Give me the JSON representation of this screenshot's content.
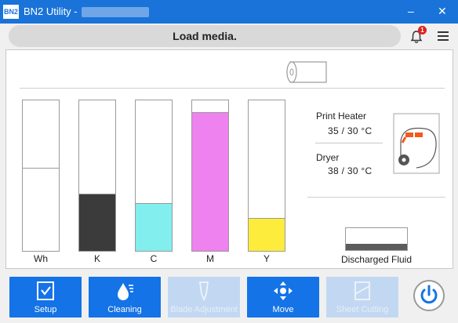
{
  "window": {
    "logo_text": "BN2",
    "title": "BN2 Utility -",
    "minimize_glyph": "–",
    "close_glyph": "✕"
  },
  "status": {
    "message": "Load media.",
    "notification_count": "1"
  },
  "ink_tanks": [
    {
      "label": "Wh",
      "level": 0.55,
      "color": "#ffffff"
    },
    {
      "label": "K",
      "level": 0.38,
      "color": "#3b3b3b"
    },
    {
      "label": "C",
      "level": 0.32,
      "color": "#82eeee"
    },
    {
      "label": "M",
      "level": 0.92,
      "color": "#ee82ee"
    },
    {
      "label": "Y",
      "level": 0.22,
      "color": "#fdec3c"
    }
  ],
  "heaters": {
    "print_heater_label": "Print Heater",
    "print_heater_value": "35 / 30 °C",
    "dryer_label": "Dryer",
    "dryer_value": "38 / 30 °C"
  },
  "discharged_fluid": {
    "label": "Discharged Fluid",
    "level": 0.3
  },
  "toolbar": {
    "setup": "Setup",
    "cleaning": "Cleaning",
    "blade_adjustment": "Blade Adjustment",
    "move": "Move",
    "sheet_cutting": "Sheet Cutting"
  },
  "colors": {
    "accent": "#1473e6",
    "disabled": "#c2d8f2",
    "status_alert": "#e02020",
    "heater_indicator": "#f25a1e"
  },
  "icons": {
    "bell": "bell-icon",
    "menu": "hamburger-menu-icon",
    "media": "media-roll-icon",
    "printer": "printer-heater-icon",
    "power": "power-icon"
  }
}
